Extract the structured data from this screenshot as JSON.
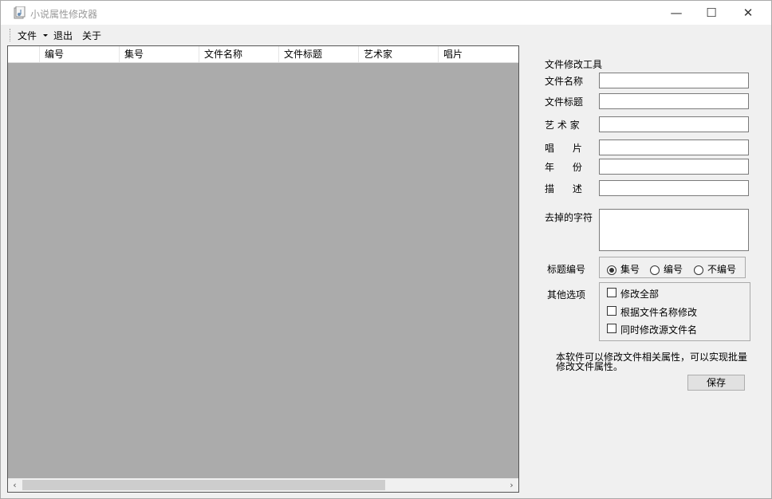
{
  "window": {
    "title": "小说属性修改器",
    "minimize": "—",
    "maximize": "☐",
    "close": "✕"
  },
  "menu": {
    "file": "文件",
    "exit": "退出",
    "about": "关于"
  },
  "grid": {
    "columns": [
      "编号",
      "集号",
      "文件名称",
      "文件标题",
      "艺术家",
      "唱片"
    ],
    "rows": [],
    "scroll_left": "‹",
    "scroll_right": "›"
  },
  "panel": {
    "section_title": "文件修改工具",
    "file_name_label": "文件名称",
    "file_title_label": "文件标题",
    "artist_label": "艺 术 家",
    "album_label": "唱      片",
    "year_label": "年      份",
    "description_label": "描      述",
    "file_name_value": "",
    "file_title_value": "",
    "artist_value": "",
    "album_value": "",
    "year_value": "",
    "description_value": "",
    "remove_chars_label": "去掉的字符",
    "remove_chars_value": "",
    "title_numbering_label": "标题编号",
    "title_numbering_options": [
      "集号",
      "编号",
      "不编号"
    ],
    "title_numbering_selected": "集号",
    "other_options_label": "其他选项",
    "other_options": [
      {
        "label": "修改全部",
        "checked": false
      },
      {
        "label": "根据文件名称修改",
        "checked": false
      },
      {
        "label": "同时修改源文件名",
        "checked": false
      }
    ],
    "description_text": "本软件可以修改文件相关属性，可以实现批量修改文件属性。",
    "save_button": "保存"
  },
  "colors": {
    "grid_background": "#ababab",
    "window_background": "#f0f0f0",
    "title_text": "#9a9a9a"
  },
  "icons": {
    "app": "music-file-icon",
    "menu_dropdown": "chevron-down-icon"
  }
}
